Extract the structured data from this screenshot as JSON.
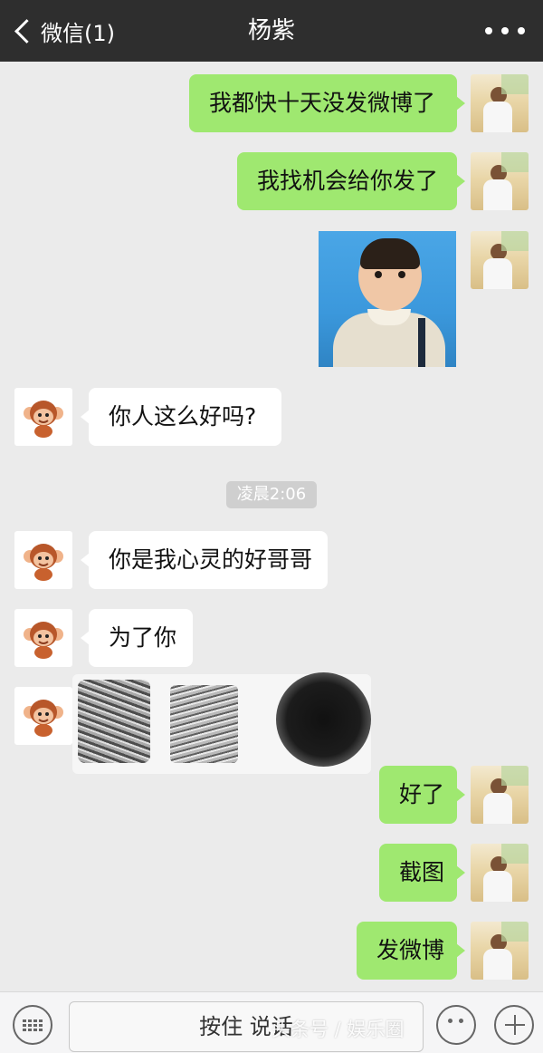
{
  "header": {
    "back_label": "微信(1)",
    "title": "杨紫"
  },
  "messages": [
    {
      "from": "me",
      "text": "我都快十天没发微博了"
    },
    {
      "from": "me",
      "text": "我找机会给你发了"
    },
    {
      "from": "me",
      "type": "image"
    },
    {
      "from": "them",
      "text": "你人这么好吗?"
    },
    {
      "from": "them",
      "text": "你是我心灵的好哥哥"
    },
    {
      "from": "them",
      "text": "为了你"
    },
    {
      "from": "them",
      "type": "redacted"
    },
    {
      "from": "me",
      "text": "好了"
    },
    {
      "from": "me",
      "text": "截图"
    },
    {
      "from": "me",
      "text": "发微博"
    }
  ],
  "timestamp": "凌晨2:06",
  "input_bar": {
    "hold_label": "按住 说话"
  },
  "watermark": "头条号 / 娱乐圈",
  "colors": {
    "header_bg": "#2e2e2e",
    "chat_bg": "#ebebeb",
    "my_bubble": "#9fe870",
    "their_bubble": "#ffffff"
  },
  "icons": {
    "back": "chevron-left-icon",
    "more": "more-dots-icon",
    "keyboard": "keyboard-icon",
    "emoji": "emoji-icon",
    "plus": "plus-icon",
    "their_avatar": "monkey-avatar-icon"
  }
}
